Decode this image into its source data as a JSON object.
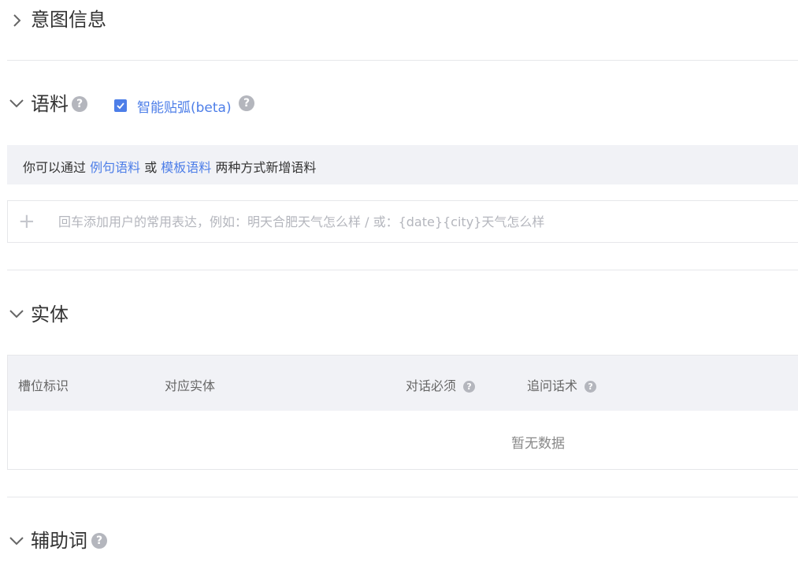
{
  "intent": {
    "title": "意图信息"
  },
  "corpus": {
    "title": "语料",
    "smart_label": "智能贴弧(beta)",
    "smart_checked": true,
    "hint": {
      "prefix": "你可以通过 ",
      "link1": "例句语料",
      "middle": " 或 ",
      "link2": "模板语料",
      "suffix": " 两种方式新增语料"
    },
    "input_placeholder": "回车添加用户的常用表达，例如：明天合肥天气怎么样 / 或：{date}{city}天气怎么样",
    "input_value": ""
  },
  "entity": {
    "title": "实体",
    "columns": [
      "槽位标识",
      "对应实体",
      "对话必须",
      "追问话术"
    ],
    "empty_text": "暂无数据"
  },
  "auxiliary": {
    "title": "辅助词"
  },
  "icons": {
    "collapsed": "chevron-right-icon",
    "expanded": "chevron-down-icon",
    "help": "question-circle-icon",
    "add": "plus-icon",
    "check": "checkmark-icon"
  },
  "colors": {
    "accent": "#4d7ee8",
    "panel_bg": "#f1f2f6",
    "border": "#e6e7ea",
    "help_icon": "#b4b6bd"
  }
}
